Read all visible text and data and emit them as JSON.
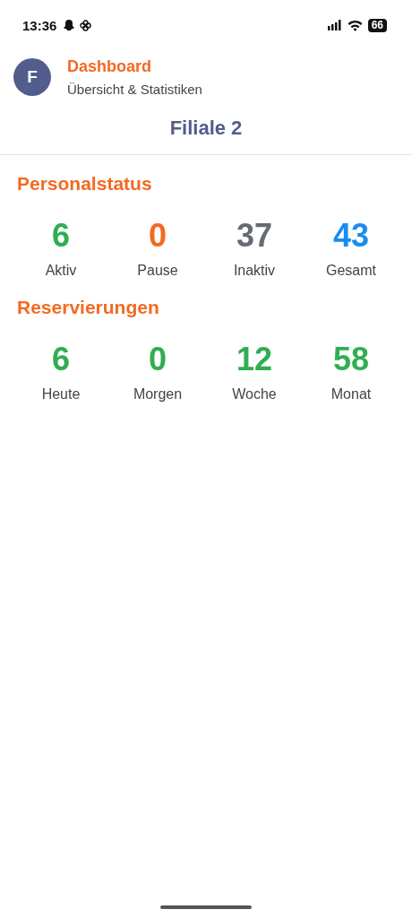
{
  "status_bar": {
    "time": "13:36",
    "battery": "66"
  },
  "header": {
    "avatar": "F",
    "title": "Dashboard",
    "subtitle": "Übersicht & Statistiken"
  },
  "branch": "Filiale 2",
  "sections": [
    {
      "title": "Personalstatus",
      "stats": [
        {
          "value": "6",
          "label": "Aktiv",
          "color": "#2fae52"
        },
        {
          "value": "0",
          "label": "Pause",
          "color": "#f26a21"
        },
        {
          "value": "37",
          "label": "Inaktiv",
          "color": "#646b75"
        },
        {
          "value": "43",
          "label": "Gesamt",
          "color": "#1a8cf0"
        }
      ]
    },
    {
      "title": "Reservierungen",
      "stats": [
        {
          "value": "6",
          "label": "Heute",
          "color": "#2fae52"
        },
        {
          "value": "0",
          "label": "Morgen",
          "color": "#2fae52"
        },
        {
          "value": "12",
          "label": "Woche",
          "color": "#2fae52"
        },
        {
          "value": "58",
          "label": "Monat",
          "color": "#2fae52"
        }
      ]
    }
  ]
}
